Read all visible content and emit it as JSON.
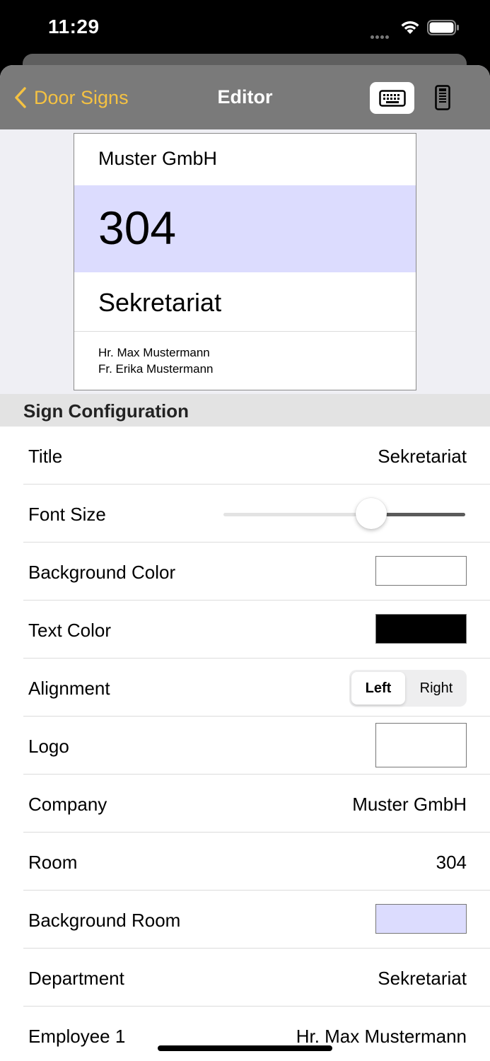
{
  "status_bar": {
    "time": "11:29"
  },
  "nav": {
    "back_label": "Door Signs",
    "title": "Editor",
    "keyboard_icon": "keyboard-icon",
    "device_icon": "device-icon"
  },
  "preview": {
    "company": "Muster GmbH",
    "room": "304",
    "department": "Sekretariat",
    "employee1": "Hr. Max Mustermann",
    "employee2": "Fr. Erika Mustermann",
    "room_background": "#dcdcfe"
  },
  "section": {
    "title": "Sign Configuration"
  },
  "rows": {
    "title": {
      "label": "Title",
      "value": "Sekretariat"
    },
    "font_size": {
      "label": "Font Size",
      "value_fraction": 0.61
    },
    "background_color": {
      "label": "Background Color",
      "color": "#ffffff"
    },
    "text_color": {
      "label": "Text Color",
      "color": "#000000"
    },
    "alignment": {
      "label": "Alignment",
      "options": [
        "Left",
        "Right"
      ],
      "selected": "Left"
    },
    "logo": {
      "label": "Logo"
    },
    "company": {
      "label": "Company",
      "value": "Muster GmbH"
    },
    "room": {
      "label": "Room",
      "value": "304"
    },
    "background_room": {
      "label": "Background Room",
      "color": "#dcdcfe"
    },
    "department": {
      "label": "Department",
      "value": "Sekretariat"
    },
    "employee1": {
      "label": "Employee 1",
      "value": "Hr. Max Mustermann"
    }
  },
  "colors": {
    "accent": "#f5c242",
    "nav_background": "#7a7a7a"
  }
}
